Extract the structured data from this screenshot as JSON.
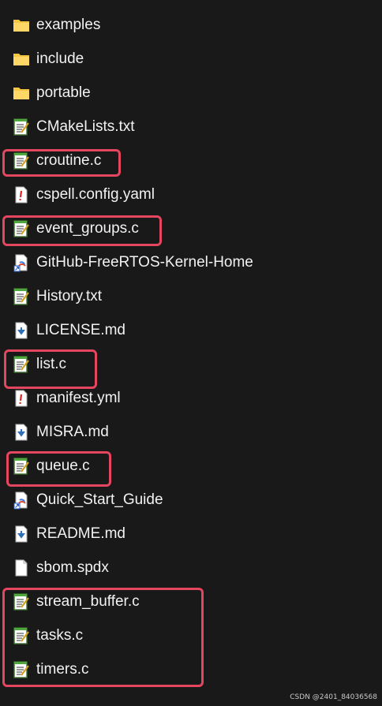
{
  "files": [
    {
      "name": "examples",
      "icon": "folder-icon"
    },
    {
      "name": "include",
      "icon": "folder-icon"
    },
    {
      "name": "portable",
      "icon": "folder-icon"
    },
    {
      "name": "CMakeLists.txt",
      "icon": "notepad-file-icon"
    },
    {
      "name": "croutine.c",
      "icon": "notepad-file-icon"
    },
    {
      "name": "cspell.config.yaml",
      "icon": "yaml-file-icon"
    },
    {
      "name": "event_groups.c",
      "icon": "notepad-file-icon"
    },
    {
      "name": "GitHub-FreeRTOS-Kernel-Home",
      "icon": "web-shortcut-icon"
    },
    {
      "name": "History.txt",
      "icon": "notepad-file-icon"
    },
    {
      "name": "LICENSE.md",
      "icon": "markdown-file-icon"
    },
    {
      "name": "list.c",
      "icon": "notepad-file-icon"
    },
    {
      "name": "manifest.yml",
      "icon": "yaml-file-icon"
    },
    {
      "name": "MISRA.md",
      "icon": "markdown-file-icon"
    },
    {
      "name": "queue.c",
      "icon": "notepad-file-icon"
    },
    {
      "name": "Quick_Start_Guide",
      "icon": "web-shortcut-icon"
    },
    {
      "name": "README.md",
      "icon": "markdown-file-icon"
    },
    {
      "name": "sbom.spdx",
      "icon": "blank-file-icon"
    },
    {
      "name": "stream_buffer.c",
      "icon": "notepad-file-icon"
    },
    {
      "name": "tasks.c",
      "icon": "notepad-file-icon"
    },
    {
      "name": "timers.c",
      "icon": "notepad-file-icon"
    }
  ],
  "highlight_color": "#e4455f",
  "watermark": "CSDN @2401_84036568"
}
